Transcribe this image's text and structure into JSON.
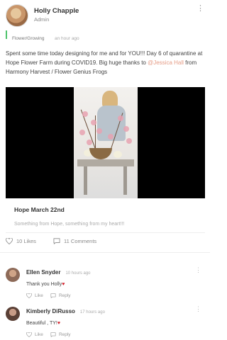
{
  "author": {
    "name": "Holly Chapple",
    "role": "Admin"
  },
  "post": {
    "category": "Flower/Growing",
    "time": "an hour ago",
    "text_before": "Spent some time today designing for me and for YOU!!! Day 6 of quarantine at Hope Flower Farm during COVID19. Big huge thanks to ",
    "mention": "@Jessica Hall",
    "text_after": " from Harmony Harvest / Flower Genius Frogs",
    "card_title": "Hope March 22nd",
    "card_subtitle": "Something from Hope, something from my heart!!!",
    "likes": "10 Likes",
    "comments": "11 Comments"
  },
  "comments": [
    {
      "name": "Ellen Snyder",
      "time": "10 hours ago",
      "text": "Thank you Holly",
      "heart": "♥",
      "like": "Like",
      "reply": "Reply"
    },
    {
      "name": "Kimberly DiRusso",
      "time": "17 hours ago",
      "text": "Beautiful , TY!",
      "heart": "♥",
      "like": "Like",
      "reply": "Reply"
    }
  ],
  "colors": {
    "accent": "#4cc36a",
    "mention": "#e59b85",
    "heart": "#d21f2a"
  }
}
